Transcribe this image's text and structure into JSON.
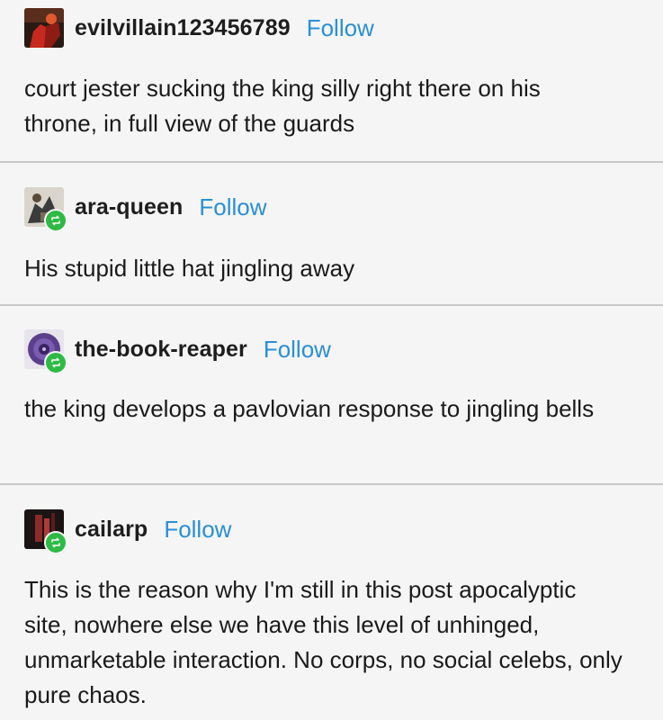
{
  "posts": [
    {
      "username": "evilvillain123456789",
      "follow_label": "Follow",
      "avatar_icon": "red-figure-avatar-icon",
      "reblog": false,
      "body": "court jester sucking the king silly right there on his throne, in full view of the guards"
    },
    {
      "username": "ara-queen",
      "follow_label": "Follow",
      "avatar_icon": "figure-avatar-icon",
      "reblog": true,
      "body": "His stupid little hat jingling away"
    },
    {
      "username": "the-book-reaper",
      "follow_label": "Follow",
      "avatar_icon": "purple-spiral-avatar-icon",
      "reblog": true,
      "body": "the king develops a pavlovian response to jingling bells"
    },
    {
      "username": "cailarp",
      "follow_label": "Follow",
      "avatar_icon": "dark-red-avatar-icon",
      "reblog": true,
      "body": "This is the reason why I'm still in this post apocalyptic site, nowhere else we have this level of unhinged, unmarketable interaction. No corps, no social celebs, only pure chaos."
    }
  ],
  "colors": {
    "follow": "#2a8fd6",
    "reblog_badge": "#2fba45",
    "divider": "#c9c9c9"
  }
}
